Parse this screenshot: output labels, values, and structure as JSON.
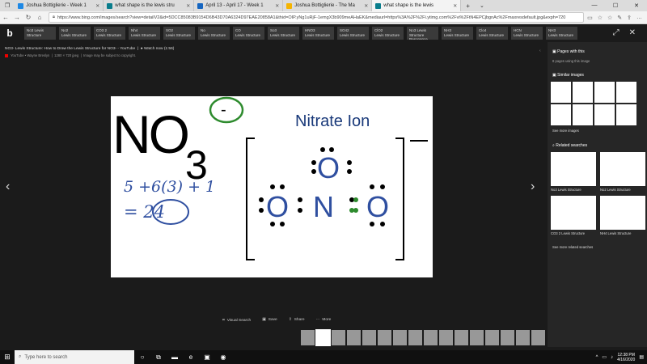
{
  "browser": {
    "tabs": [
      {
        "label": "Joshua Bottiglierie - Week 1",
        "color": "#1e88e5"
      },
      {
        "label": "what shape is the lewis stru",
        "color": "#0a7d8c"
      },
      {
        "label": "April 13 - April 17 - Week 1",
        "color": "#1565c0"
      },
      {
        "label": "Joshua Bottiglierie - The Ma",
        "color": "#f5b400"
      },
      {
        "label": "what shape is the lewis",
        "color": "#0a7d8c"
      }
    ],
    "new_tab": "+",
    "tab_chevron": "⌄",
    "url": "https://www.bing.com/images/search?view=detailV2&id=5DCC85083B9154D6B43D70A6324D97EAE20858A1&thid=OIP.yNg1uRjF-1emgX3b909meAHaEK&mediaurl=https%3A%2F%2Fi.ytimg.com%2Fvi%2FtN4EPCjbgnAc%2Fmaxresdefault.jpg&exph=720"
  },
  "bing": {
    "logo": "b",
    "related_searches": [
      {
        "line1": "No3 Lewis Structure",
        "line2": ""
      },
      {
        "line1": "No2",
        "line2": "Lewis Structure"
      },
      {
        "line1": "CO3 2",
        "line2": "Lewis Structure"
      },
      {
        "line1": "Nh4",
        "line2": "Lewis Structure"
      },
      {
        "line1": "SO2",
        "line2": "Lewis Structure"
      },
      {
        "line1": "No",
        "line2": "Lewis Structure"
      },
      {
        "line1": "CO",
        "line2": "Lewis Structure"
      },
      {
        "line1": "So3",
        "line2": "Lewis Structure"
      },
      {
        "line1": "HNO3",
        "line2": "Lewis Structure"
      },
      {
        "line1": "SO42",
        "line2": "Lewis Structure"
      },
      {
        "line1": "ClO2",
        "line2": "Lewis Structure"
      },
      {
        "line1": "No3 Lewis Structure",
        "line2": "Resonance"
      },
      {
        "line1": "NH3",
        "line2": "Lewis Structure"
      },
      {
        "line1": "Clo4",
        "line2": "Lewis Structure"
      },
      {
        "line1": "HCN",
        "line2": "Lewis Structure"
      },
      {
        "line1": "NH3",
        "line2": "Lewis Structure"
      }
    ]
  },
  "detail": {
    "title": "NO3- Lewis Structure: How to Draw the Lewis Structure for NO3- - YouTube",
    "watch_now": "Watch now (1:56)",
    "source": "YouTube",
    "author": "Wayne Breslyn",
    "dimensions": "1280 × 720 jpeg",
    "copyright": "Image may be subject to copyright.",
    "image": {
      "formula": "NO",
      "subscript": "3",
      "charge": "-",
      "heading": "Nitrate Ion",
      "calc_line1": "5 +6(3) + 1",
      "calc_line2": "= 24",
      "atom_o": "O",
      "atom_n": "N"
    },
    "actions": [
      "Visual Search",
      "Save",
      "Share",
      "More"
    ],
    "feedback": "Feedback"
  },
  "panel": {
    "pages_title": "Pages with this",
    "pages_sub": "8 pages using this image",
    "similar_title": "Similar images",
    "see_more_images": "See more images",
    "related_title": "Related searches",
    "related": [
      {
        "caption": "No3 Lewis Structure"
      },
      {
        "caption": "No2 Lewis Structure"
      },
      {
        "caption": "CO3 2 Lewis Structure"
      },
      {
        "caption": "NH4 Lewis Structure"
      }
    ],
    "see_more_related": "See more related searches"
  },
  "taskbar": {
    "search_placeholder": "Type here to search",
    "time": "12:38 PM",
    "date": "4/16/2020"
  }
}
